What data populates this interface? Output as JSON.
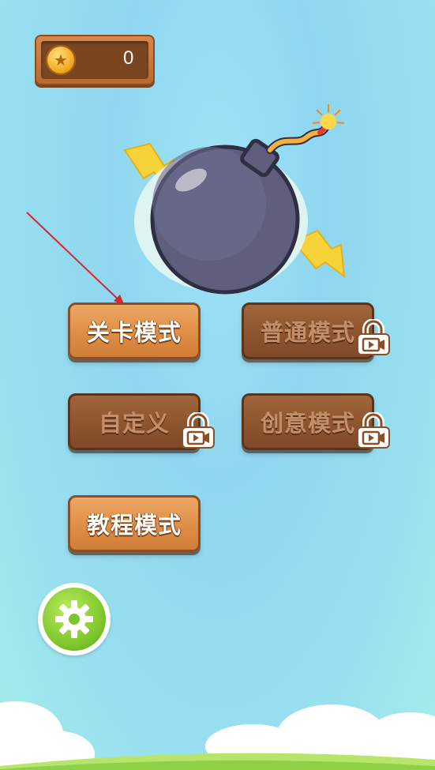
{
  "coins": {
    "count": "0"
  },
  "menu": {
    "level_mode": "关卡模式",
    "normal_mode": "普通模式",
    "custom_mode": "自定义",
    "creative_mode": "创意模式",
    "tutorial_mode": "教程模式"
  },
  "icons": {
    "coin": "coin-icon",
    "lock": "lock-video-icon",
    "settings": "gear-icon",
    "bomb": "bomb-icon"
  },
  "colors": {
    "wood_active": "#e3924a",
    "wood_locked": "#8f5630",
    "settings_green": "#7cc52a",
    "sky": "#9fe3f7"
  }
}
